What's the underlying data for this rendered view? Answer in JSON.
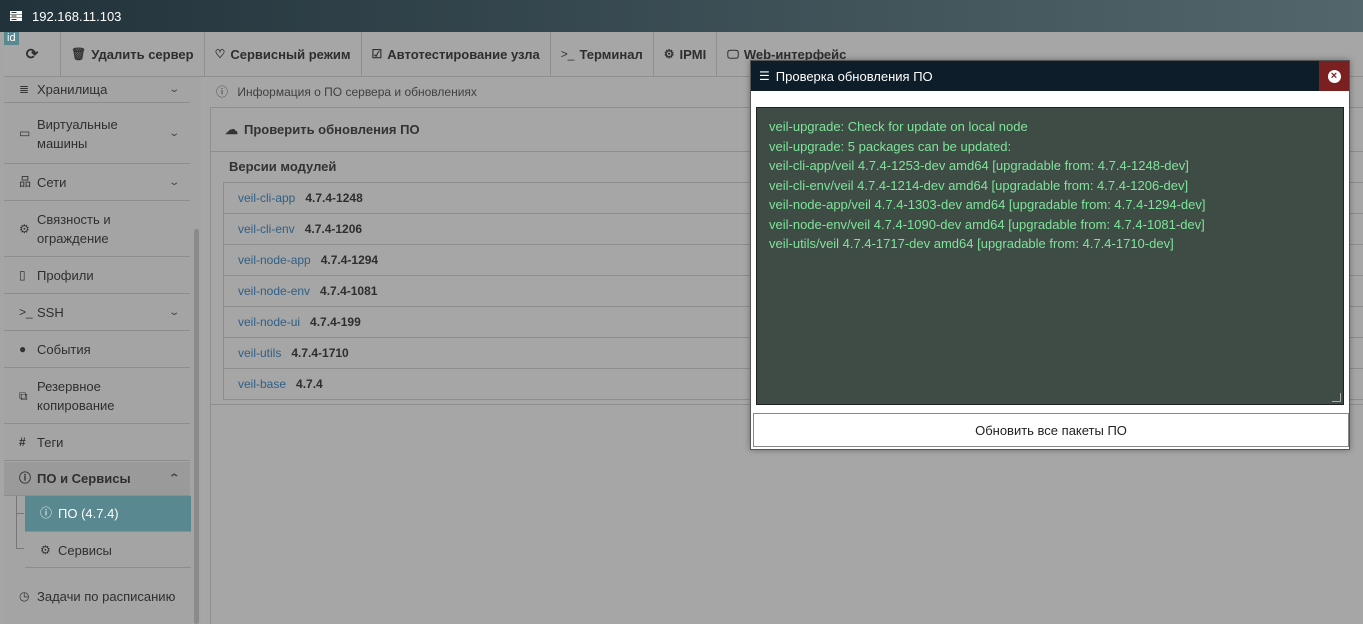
{
  "window": {
    "title": "192.168.11.103",
    "id_badge": "id"
  },
  "toolbar": {
    "refresh_icon": "refresh-icon",
    "buttons": [
      {
        "label": "Удалить сервер",
        "icon": "trash-icon"
      },
      {
        "label": "Сервисный режим",
        "icon": "heartbeat-icon"
      },
      {
        "label": "Автотестирование узла",
        "icon": "check-square-icon"
      },
      {
        "label": "Терминал",
        "icon": "terminal-icon"
      },
      {
        "label": "IPMI",
        "icon": "gears-icon"
      },
      {
        "label": "Web-интерфейс",
        "icon": "desktop-icon"
      }
    ]
  },
  "sidebar": {
    "items": [
      {
        "label": "Хранилища"
      },
      {
        "label": "Виртуальные машины"
      },
      {
        "label": "Сети"
      },
      {
        "label": "Связность и ограждение"
      },
      {
        "label": "Профили"
      },
      {
        "label": "SSH"
      },
      {
        "label": "События"
      },
      {
        "label": "Резервное копирование"
      },
      {
        "label": "Теги"
      },
      {
        "label": "ПО и Сервисы"
      },
      {
        "label": "ПО (4.7.4)"
      },
      {
        "label": "Сервисы"
      },
      {
        "label": "Задачи по расписанию"
      }
    ]
  },
  "main": {
    "info": "Информация о ПО сервера и обновлениях",
    "check_updates": "Проверить обновления ПО",
    "modules_title": "Версии модулей",
    "modules": [
      {
        "name": "veil-cli-app",
        "version": "4.7.4-1248"
      },
      {
        "name": "veil-cli-env",
        "version": "4.7.4-1206"
      },
      {
        "name": "veil-node-app",
        "version": "4.7.4-1294"
      },
      {
        "name": "veil-node-env",
        "version": "4.7.4-1081"
      },
      {
        "name": "veil-node-ui",
        "version": "4.7.4-199"
      },
      {
        "name": "veil-utils",
        "version": "4.7.4-1710"
      },
      {
        "name": "veil-base",
        "version": "4.7.4"
      }
    ]
  },
  "modal": {
    "title": "Проверка обновления ПО",
    "console_lines": [
      "veil-upgrade: Check for update on local node",
      "veil-upgrade: 5 packages can be updated:",
      "veil-cli-app/veil 4.7.4-1253-dev amd64 [upgradable from: 4.7.4-1248-dev]",
      "veil-cli-env/veil 4.7.4-1214-dev amd64 [upgradable from: 4.7.4-1206-dev]",
      "veil-node-app/veil 4.7.4-1303-dev amd64 [upgradable from: 4.7.4-1294-dev]",
      "veil-node-env/veil 4.7.4-1090-dev amd64 [upgradable from: 4.7.4-1081-dev]",
      "veil-utils/veil 4.7.4-1717-dev amd64 [upgradable from: 4.7.4-1710-dev]"
    ],
    "update_all_button": "Обновить все пакеты ПО"
  },
  "colors": {
    "accent": "#5a8891",
    "modal_header": "#0e1d2a",
    "console_bg": "#3f4b45",
    "console_text": "#7ee49a",
    "close_bg": "#7a2020"
  }
}
